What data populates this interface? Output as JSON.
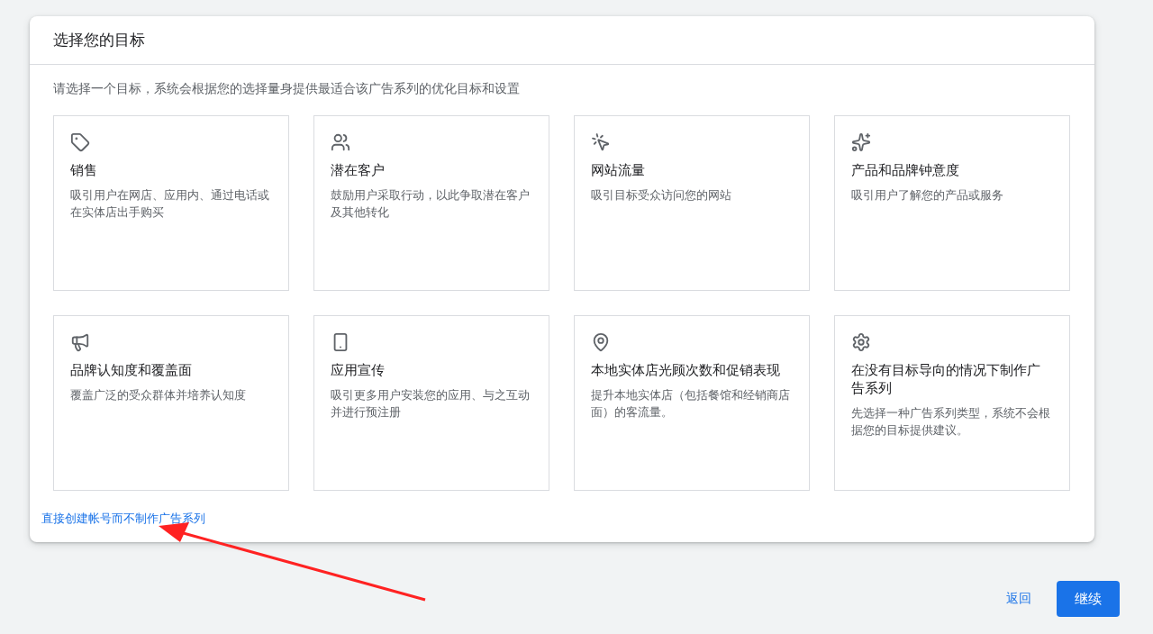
{
  "dialog": {
    "title": "选择您的目标",
    "intro": "请选择一个目标，系统会根据您的选择量身提供最适合该广告系列的优化目标和设置",
    "goals": [
      {
        "title": "销售",
        "description": "吸引用户在网店、应用内、通过电话或在实体店出手购买"
      },
      {
        "title": "潜在客户",
        "description": "鼓励用户采取行动，以此争取潜在客户及其他转化"
      },
      {
        "title": "网站流量",
        "description": "吸引目标受众访问您的网站"
      },
      {
        "title": "产品和品牌钟意度",
        "description": "吸引用户了解您的产品或服务"
      },
      {
        "title": "品牌认知度和覆盖面",
        "description": "覆盖广泛的受众群体并培养认知度"
      },
      {
        "title": "应用宣传",
        "description": "吸引更多用户安装您的应用、与之互动并进行预注册"
      },
      {
        "title": "本地实体店光顾次数和促销表现",
        "description": "提升本地实体店（包括餐馆和经销商店面）的客流量。"
      },
      {
        "title": "在没有目标导向的情况下制作广告系列",
        "description": "先选择一种广告系列类型，系统不会根据您的目标提供建议。"
      }
    ],
    "skip_link": "直接创建帐号而不制作广告系列"
  },
  "footer": {
    "back": "返回",
    "continue": "继续"
  }
}
